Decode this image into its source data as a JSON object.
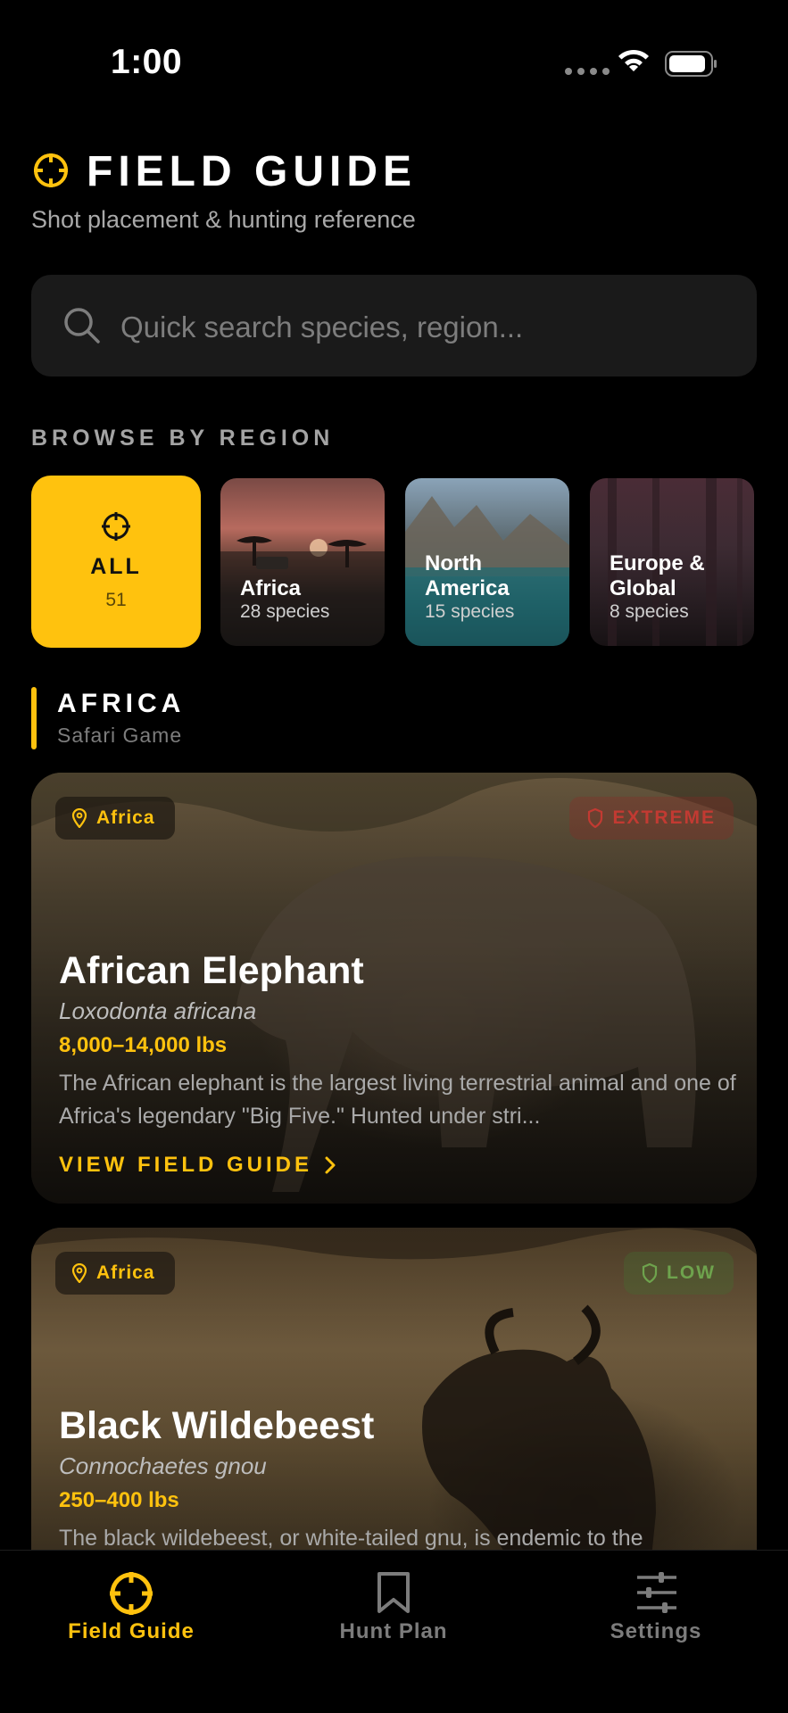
{
  "status": {
    "time": "1:00"
  },
  "header": {
    "title": "FIELD GUIDE",
    "subtitle": "Shot placement & hunting reference"
  },
  "search": {
    "placeholder": "Quick search species, region..."
  },
  "browse": {
    "label": "BROWSE BY REGION",
    "regions": [
      {
        "name": "ALL",
        "count": "51"
      },
      {
        "name": "Africa",
        "count": "28 species"
      },
      {
        "name": "North\nAmerica",
        "count": "15 species"
      },
      {
        "name": "Europe &\nGlobal",
        "count": "8 species"
      }
    ]
  },
  "section": {
    "title": "AFRICA",
    "subtitle": "Safari Game"
  },
  "cards": [
    {
      "region": "Africa",
      "danger": "EXTREME",
      "name": "African Elephant",
      "scientific": "Loxodonta africana",
      "weight": "8,000–14,000 lbs",
      "description": "The African elephant is the largest living terrestrial animal and one of Africa's legendary \"Big Five.\" Hunted under stri...",
      "link": "VIEW FIELD GUIDE"
    },
    {
      "region": "Africa",
      "danger": "LOW",
      "name": "Black Wildebeest",
      "scientific": "Connochaetes gnou",
      "weight": "250–400 lbs",
      "description": "The black wildebeest, or white-tailed gnu, is endemic to the"
    }
  ],
  "tabs": [
    {
      "label": "Field Guide",
      "icon": "crosshair-icon",
      "active": true
    },
    {
      "label": "Hunt Plan",
      "icon": "bookmark-icon",
      "active": false
    },
    {
      "label": "Settings",
      "icon": "sliders-icon",
      "active": false
    }
  ],
  "colors": {
    "accent": "#ffc20e",
    "background": "#000000",
    "danger_extreme": "#c23a32",
    "danger_low": "#6ea34d"
  }
}
